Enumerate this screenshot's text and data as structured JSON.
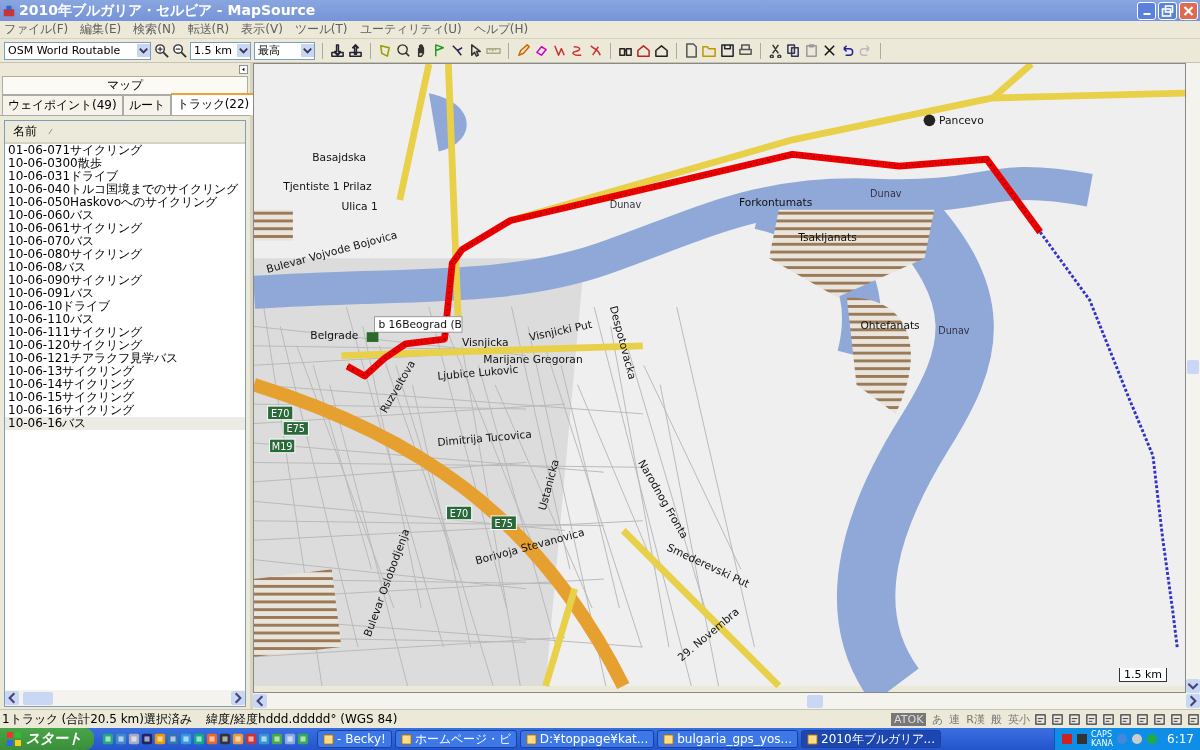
{
  "window": {
    "title": "2010年ブルガリア・セルビア - MapSource"
  },
  "menu": [
    "ファイル(F)",
    "編集(E)",
    "検索(N)",
    "転送(R)",
    "表示(V)",
    "ツール(T)",
    "ユーティリティ(U)",
    "ヘルプ(H)"
  ],
  "toolbar": {
    "map_product": "OSM World Routable",
    "zoom_scale": "1.5 km",
    "detail": "最高"
  },
  "sidebar": {
    "header": "マップ",
    "tabs": [
      {
        "label": "ウェイポイント(49)",
        "selected": false
      },
      {
        "label": "ルート",
        "selected": false
      },
      {
        "label": "トラック(22)",
        "selected": true
      }
    ],
    "column": "名前",
    "items": [
      {
        "name": "01-06-071サイクリング",
        "selected": false
      },
      {
        "name": "10-06-0300散歩",
        "selected": false
      },
      {
        "name": "10-06-031ドライブ",
        "selected": false
      },
      {
        "name": "10-06-040トルコ国境までのサイクリング",
        "selected": false
      },
      {
        "name": "10-06-050Haskovoへのサイクリング",
        "selected": false
      },
      {
        "name": "10-06-060バス",
        "selected": false
      },
      {
        "name": "10-06-061サイクリング",
        "selected": false
      },
      {
        "name": "10-06-070バス",
        "selected": false
      },
      {
        "name": "10-06-080サイクリング",
        "selected": false
      },
      {
        "name": "10-06-08バス",
        "selected": false
      },
      {
        "name": "10-06-090サイクリング",
        "selected": false
      },
      {
        "name": "10-06-091バス",
        "selected": false
      },
      {
        "name": "10-06-10ドライブ",
        "selected": false
      },
      {
        "name": "10-06-110バス",
        "selected": false
      },
      {
        "name": "10-06-111サイクリング",
        "selected": false
      },
      {
        "name": "10-06-120サイクリング",
        "selected": false
      },
      {
        "name": "10-06-121チアラクフ見学バス",
        "selected": false
      },
      {
        "name": "10-06-13サイクリング",
        "selected": false
      },
      {
        "name": "10-06-14サイクリング",
        "selected": false
      },
      {
        "name": "10-06-15サイクリング",
        "selected": false
      },
      {
        "name": "10-06-16サイクリング",
        "selected": false
      },
      {
        "name": "10-06-16バス",
        "selected": true
      }
    ]
  },
  "map": {
    "labels": [
      "Pancevo",
      "Basajdska",
      "Tjentiste 1 Prilaz",
      "Ulica 1",
      "Dunav",
      "Dunav",
      "Dunav",
      "Forkontumats",
      "Tsakljanats",
      "Ohtefanats",
      "Visnjicki Put",
      "Marijane Gregoran",
      "Ljubice Lukovic",
      "Dimitrija Tucovica",
      "Borivoja Stevanovica",
      "Smederevski Put",
      "29. Novembra",
      "Bulevar Vojvode Bojovica",
      "Bulevar Oslobodjenja",
      "Despotovacka",
      "Ustanicka",
      "Narodnog Fronta",
      "Ruzveltova",
      "Belgrade",
      "Visnjicka"
    ],
    "shields": [
      "E70",
      "E75",
      "M19",
      "E70",
      "E75"
    ],
    "callout": "b 16Beograd (B",
    "scale": "1.5 km"
  },
  "status_bar": {
    "selection": "1トラック (合計20.5 km)選択済み",
    "coordinates": "緯度/経度hddd.ddddd° (WGS 84)",
    "ime": [
      "ATOK",
      "あ",
      "連",
      "R漢",
      "般",
      "英小"
    ]
  },
  "taskbar": {
    "start": "スタート",
    "tasks": [
      {
        "label": "- Becky!",
        "selected": false
      },
      {
        "label": "ホームページ・ビ",
        "selected": false
      },
      {
        "label": "D:¥toppage¥kat...",
        "selected": false
      },
      {
        "label": "bulgaria_gps_yos...",
        "selected": false
      },
      {
        "label": "2010年ブルガリア...",
        "selected": true
      }
    ],
    "tray": [
      "CAPS",
      "KANA"
    ],
    "clock": "6:17"
  }
}
